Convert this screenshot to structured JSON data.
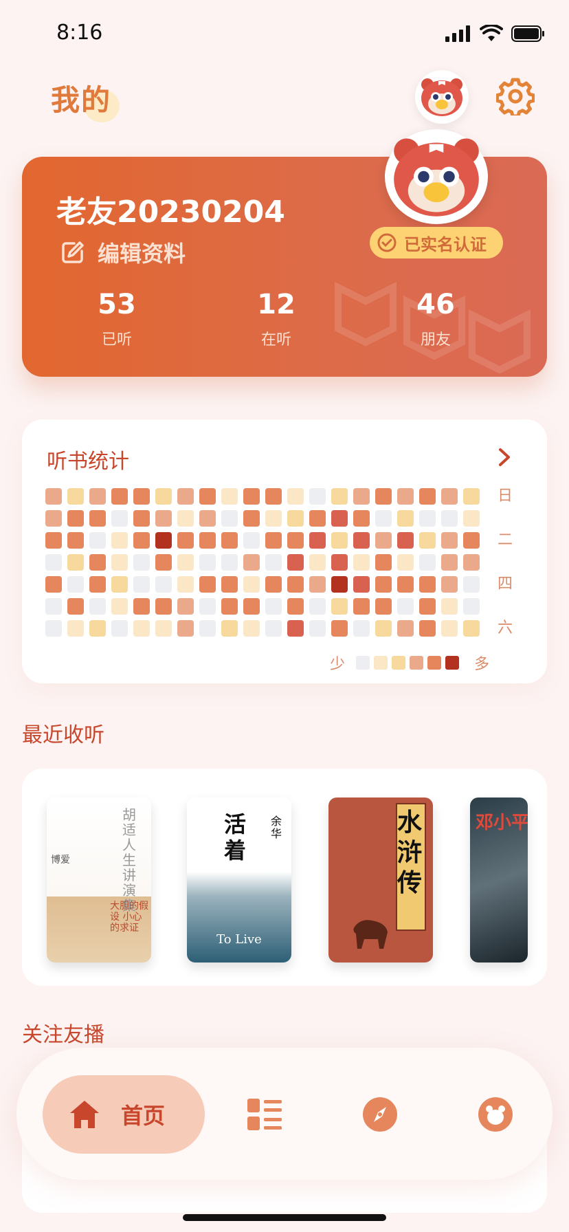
{
  "status": {
    "time": "8:16"
  },
  "header": {
    "title": "我的"
  },
  "profile": {
    "name": "老友20230204",
    "edit_label": "编辑资料",
    "verified_label": "已实名认证",
    "stats": [
      {
        "value": "53",
        "label": "已听"
      },
      {
        "value": "12",
        "label": "在听"
      },
      {
        "value": "46",
        "label": "朋友"
      }
    ]
  },
  "listening_stats": {
    "title": "听书统计",
    "day_labels": [
      "日",
      "二",
      "四",
      "六"
    ],
    "legend_low": "少",
    "legend_high": "多",
    "colors": [
      "#eceef2",
      "#fbe6c6",
      "#f8d99d",
      "#e9a98a",
      "#e5865c",
      "#d96150",
      "#b2311f"
    ],
    "grid_levels": [
      [
        3,
        2,
        3,
        4,
        4,
        2,
        3,
        4,
        1,
        4,
        4,
        1,
        0,
        2,
        3,
        4,
        3,
        4,
        3,
        2
      ],
      [
        3,
        4,
        4,
        0,
        4,
        3,
        1,
        3,
        0,
        4,
        1,
        2,
        4,
        5,
        4,
        0,
        2,
        0,
        0,
        1
      ],
      [
        4,
        4,
        0,
        1,
        4,
        6,
        4,
        4,
        4,
        0,
        4,
        4,
        5,
        2,
        5,
        3,
        5,
        2,
        3,
        4
      ],
      [
        0,
        2,
        4,
        1,
        0,
        4,
        1,
        0,
        0,
        3,
        0,
        5,
        1,
        5,
        1,
        4,
        1,
        0,
        3,
        3
      ],
      [
        4,
        0,
        4,
        2,
        0,
        0,
        1,
        4,
        4,
        1,
        4,
        4,
        3,
        6,
        5,
        4,
        4,
        4,
        3,
        0
      ],
      [
        0,
        4,
        0,
        1,
        4,
        4,
        3,
        0,
        4,
        4,
        0,
        4,
        0,
        2,
        4,
        4,
        0,
        4,
        1,
        0
      ],
      [
        0,
        1,
        2,
        0,
        1,
        1,
        3,
        0,
        2,
        1,
        0,
        5,
        0,
        4,
        0,
        2,
        3,
        4,
        1,
        2
      ]
    ]
  },
  "recent": {
    "title": "最近收听",
    "books": [
      {
        "title": "胡适人生讲演集",
        "subtitle": "大胆的假设 小心的求证",
        "tag": "博爱"
      },
      {
        "title": "活着",
        "author": "余华",
        "en": "To Live"
      },
      {
        "title": "水浒传"
      },
      {
        "title": "邓小平"
      }
    ]
  },
  "follow": {
    "title": "关注友播"
  },
  "tabbar": {
    "home_label": "首页"
  }
}
